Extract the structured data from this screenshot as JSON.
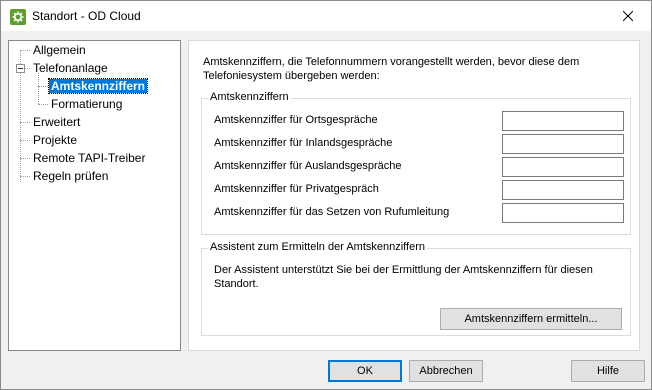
{
  "window": {
    "title": "Standort - OD Cloud",
    "close_glyph": "✕"
  },
  "tree": {
    "items": [
      {
        "label": "Allgemein"
      },
      {
        "label": "Telefonanlage"
      },
      {
        "label": "Amtskennziffern",
        "selected": true
      },
      {
        "label": "Formatierung"
      },
      {
        "label": "Erweitert"
      },
      {
        "label": "Projekte"
      },
      {
        "label": "Remote TAPI-Treiber"
      },
      {
        "label": "Regeln prüfen"
      }
    ]
  },
  "panel": {
    "intro": "Amtskennziffern, die Telefonnummern vorangestellt werden, bevor diese dem Telefoniesystem übergeben werden:",
    "codes_group": {
      "title": "Amtskennziffern",
      "fields": [
        {
          "label": "Amtskennziffer für Ortsgespräche",
          "value": ""
        },
        {
          "label": "Amtskennziffer für Inlandsgespräche",
          "value": ""
        },
        {
          "label": "Amtskennziffer für Auslandsgespräche",
          "value": ""
        },
        {
          "label": "Amtskennziffer für Privatgespräch",
          "value": ""
        },
        {
          "label": "Amtskennziffer für das Setzen von Rufumleitung",
          "value": ""
        }
      ]
    },
    "assistant_group": {
      "title": "Assistent zum Ermitteln der Amtskennziffern",
      "text": "Der Assistent unterstützt Sie bei der Ermittlung der Amtskennziffern für diesen Standort.",
      "button": "Amtskennziffern ermitteln..."
    }
  },
  "footer": {
    "ok": "OK",
    "cancel": "Abbrechen",
    "help": "Hilfe"
  },
  "colors": {
    "selection": "#0078d7",
    "app_icon": "#5e9e2e"
  }
}
